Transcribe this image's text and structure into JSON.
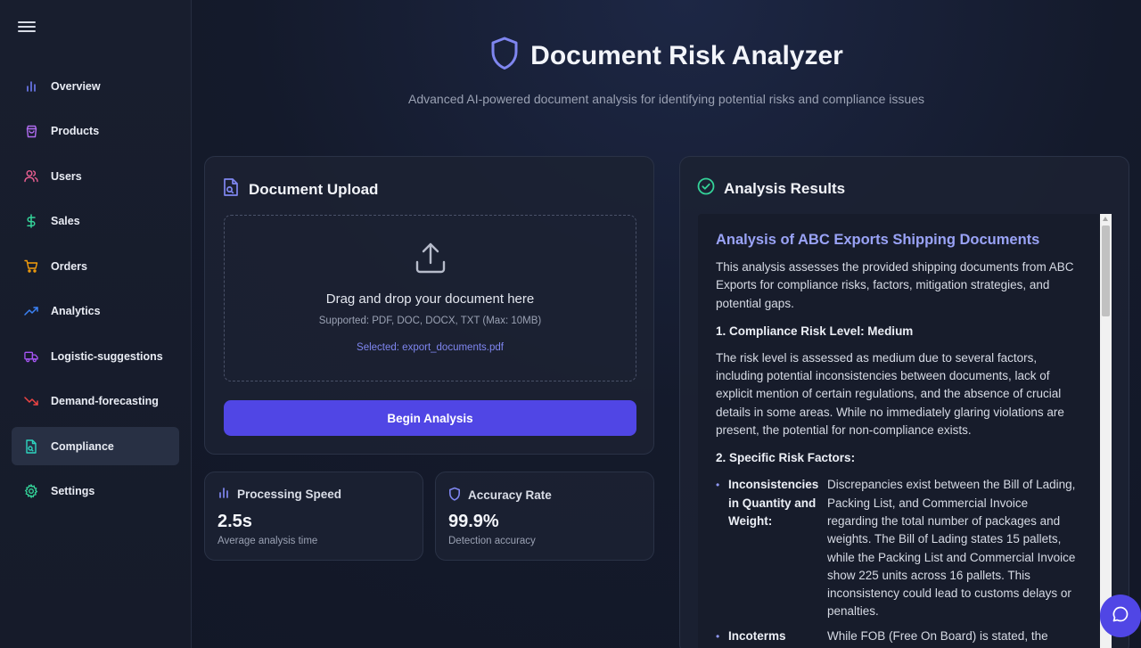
{
  "sidebar": {
    "items": [
      {
        "label": "Overview",
        "icon": "bar-chart-icon"
      },
      {
        "label": "Products",
        "icon": "shopping-bag-icon"
      },
      {
        "label": "Users",
        "icon": "users-icon"
      },
      {
        "label": "Sales",
        "icon": "dollar-icon"
      },
      {
        "label": "Orders",
        "icon": "cart-icon"
      },
      {
        "label": "Analytics",
        "icon": "trending-up-icon"
      },
      {
        "label": "Logistic-suggestions",
        "icon": "truck-icon"
      },
      {
        "label": "Demand-forecasting",
        "icon": "trending-down-icon"
      },
      {
        "label": "Compliance",
        "icon": "file-search-icon"
      },
      {
        "label": "Settings",
        "icon": "gear-icon"
      }
    ],
    "active": "Compliance"
  },
  "header": {
    "title": "Document Risk Analyzer",
    "subtitle": "Advanced AI-powered document analysis for identifying potential risks and compliance issues"
  },
  "upload": {
    "title": "Document Upload",
    "drop_text": "Drag and drop your document here",
    "supported": "Supported: PDF, DOC, DOCX, TXT (Max: 10MB)",
    "selected": "Selected: export_documents.pdf",
    "button": "Begin Analysis"
  },
  "stats": [
    {
      "title": "Processing Speed",
      "value": "2.5s",
      "desc": "Average analysis time"
    },
    {
      "title": "Accuracy Rate",
      "value": "99.9%",
      "desc": "Detection accuracy"
    }
  ],
  "results": {
    "title": "Analysis Results",
    "heading": "Analysis of ABC Exports Shipping Documents",
    "intro": "This analysis assesses the provided shipping documents from ABC Exports for compliance risks, factors, mitigation strategies, and potential gaps.",
    "section1_heading": "1. Compliance Risk Level: Medium",
    "section1_text": "The risk level is assessed as medium due to several factors, including potential inconsistencies between documents, lack of explicit mention of certain regulations, and the absence of crucial details in some areas. While no immediately glaring violations are present, the potential for non-compliance exists.",
    "section2_heading": "2. Specific Risk Factors:",
    "factor1_term": "Inconsistencies in Quantity and Weight:",
    "factor1_text": "Discrepancies exist between the Bill of Lading, Packing List, and Commercial Invoice regarding the total number of packages and weights. The Bill of Lading states 15 pallets, while the Packing List and Commercial Invoice show 225 units across 16 pallets. This inconsistency could lead to customs delays or penalties.",
    "factor2_term": "Incoterms",
    "factor2_text": "While FOB (Free On Board) is stated, the specific"
  },
  "colors": {
    "accent": "#5046e5",
    "link": "#7f86f0",
    "heading": "#9aa3f7",
    "success": "#34d399"
  }
}
